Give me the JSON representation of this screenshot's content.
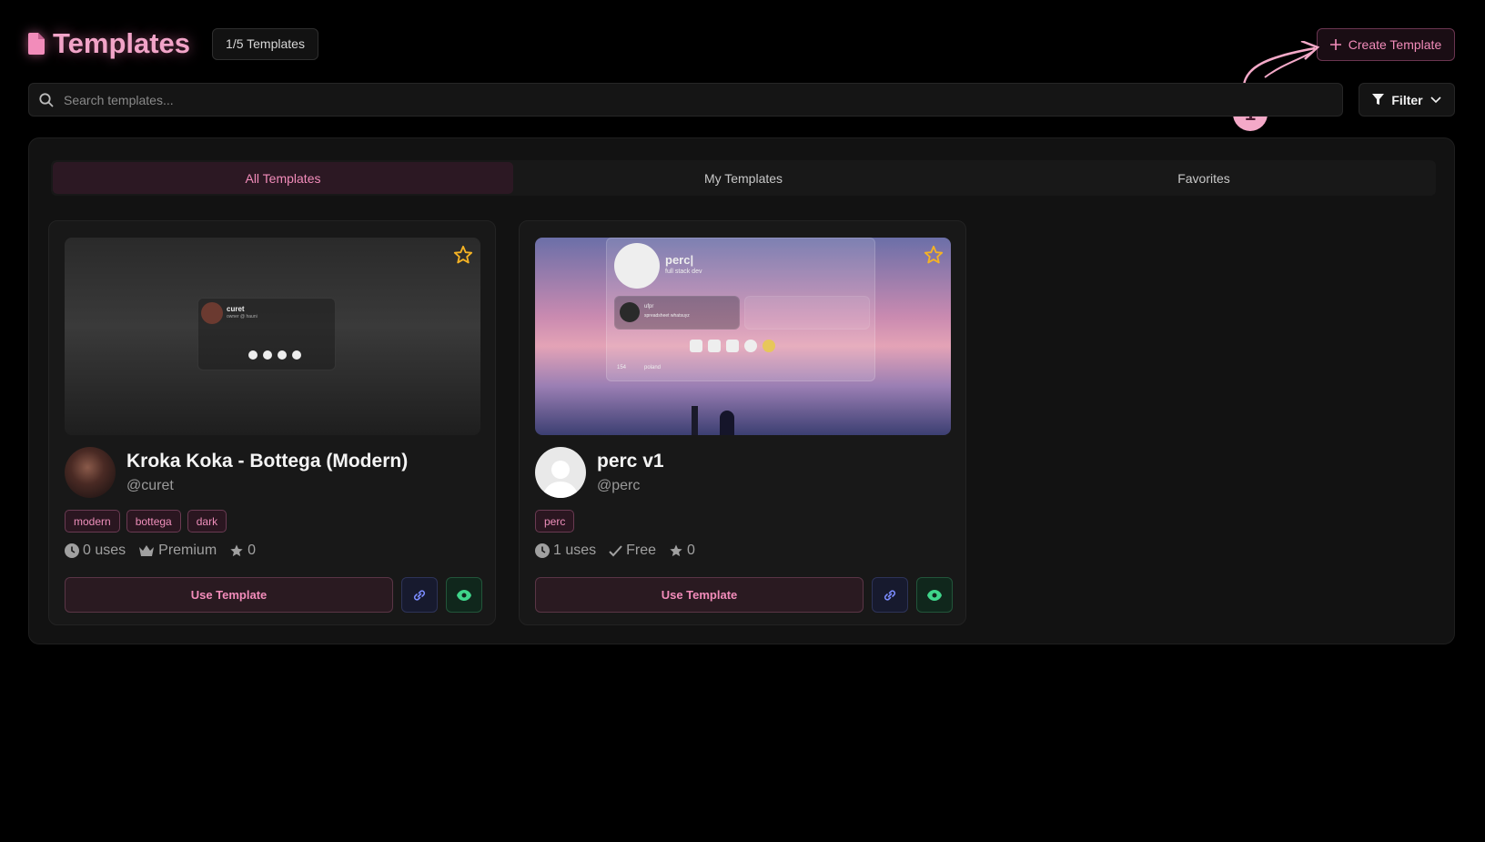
{
  "header": {
    "title": "Templates",
    "count_badge": "1/5 Templates",
    "create_label": "Create Template"
  },
  "annotation": {
    "number": "1"
  },
  "search": {
    "placeholder": "Search templates..."
  },
  "filter": {
    "label": "Filter"
  },
  "tabs": [
    {
      "label": "All Templates",
      "active": true
    },
    {
      "label": "My Templates",
      "active": false
    },
    {
      "label": "Favorites",
      "active": false
    }
  ],
  "cards": [
    {
      "title": "Kroka Koka - Bottega (Modern)",
      "author": "@curet",
      "tags": [
        "modern",
        "bottega",
        "dark"
      ],
      "uses": "0 uses",
      "tier": "Premium",
      "stars": "0",
      "use_label": "Use Template",
      "preview": {
        "name": "curet",
        "status": "owner @ hauni"
      }
    },
    {
      "title": "perc v1",
      "author": "@perc",
      "tags": [
        "perc"
      ],
      "uses": "1 uses",
      "tier": "Free",
      "stars": "0",
      "use_label": "Use Template",
      "preview": {
        "name": "perc|",
        "bio": "full stack dev",
        "views": "154",
        "location": "poland",
        "friend": "ufpr",
        "friend_status": "spreadsheet whatsuyz"
      }
    }
  ],
  "colors": {
    "accent": "#f28cba",
    "background": "#000000",
    "panel": "#121212",
    "star": "#f5b324",
    "link": "#7b8cff",
    "view": "#3fd58a"
  },
  "icons": [
    "document-icon",
    "plus-icon",
    "search-icon",
    "filter-icon",
    "chevron-down-icon",
    "star-icon",
    "clock-icon",
    "crown-icon",
    "check-icon",
    "link-icon",
    "eye-icon"
  ]
}
